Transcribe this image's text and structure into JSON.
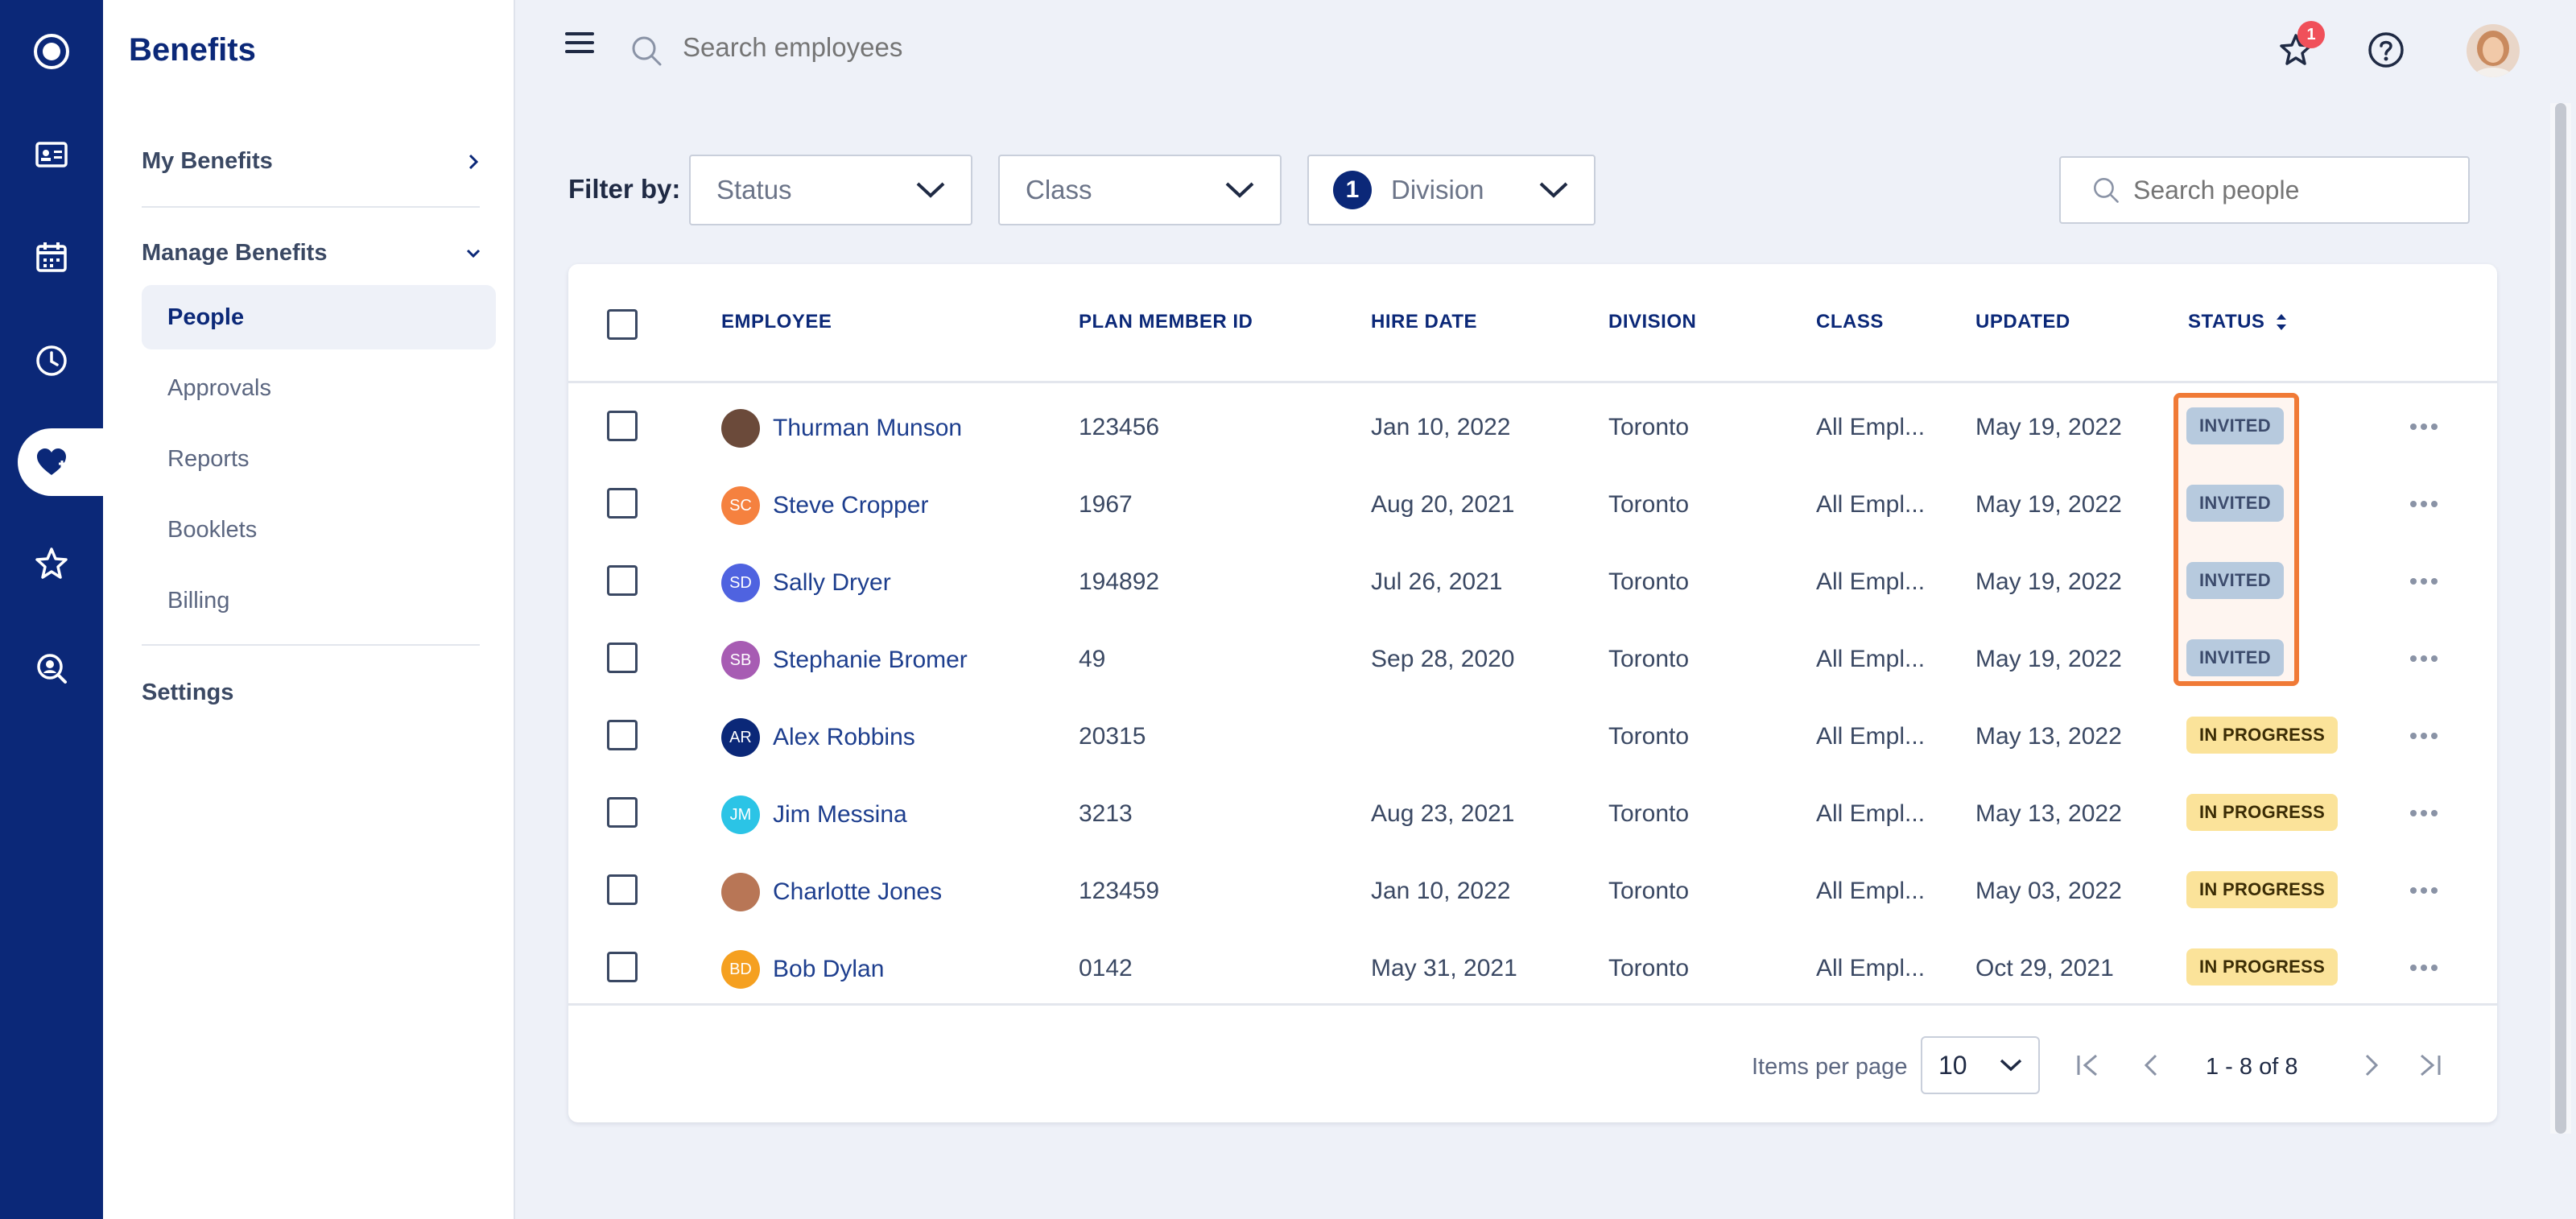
{
  "sidebar": {
    "title": "Benefits",
    "my_benefits": "My Benefits",
    "manage_benefits": "Manage Benefits",
    "items": [
      {
        "label": "People",
        "active": true
      },
      {
        "label": "Approvals"
      },
      {
        "label": "Reports"
      },
      {
        "label": "Booklets"
      },
      {
        "label": "Billing"
      }
    ],
    "settings": "Settings"
  },
  "rail_icons": [
    "logo-icon",
    "id-card-icon",
    "calendar-icon",
    "clock-icon",
    "benefits-heart-icon",
    "star-icon",
    "search-person-icon"
  ],
  "topbar": {
    "search_placeholder": "Search employees",
    "notification_count": "1"
  },
  "filters": {
    "label": "Filter by:",
    "status": "Status",
    "class": "Class",
    "division": "Division",
    "division_count": "1",
    "search_placeholder": "Search people"
  },
  "table": {
    "headers": {
      "employee": "EMPLOYEE",
      "plan_member_id": "PLAN MEMBER ID",
      "hire_date": "HIRE DATE",
      "division": "DIVISION",
      "class": "CLASS",
      "updated": "UPDATED",
      "status": "STATUS"
    },
    "rows": [
      {
        "initials": "",
        "avatar_color": "#6b4a3a",
        "name": "Thurman Munson",
        "id": "123456",
        "hire": "Jan 10, 2022",
        "division": "Toronto",
        "class": "All Empl...",
        "updated": "May 19, 2022",
        "status": "INVITED"
      },
      {
        "initials": "SC",
        "avatar_color": "#f5813f",
        "name": "Steve Cropper",
        "id": "1967",
        "hire": "Aug 20, 2021",
        "division": "Toronto",
        "class": "All Empl...",
        "updated": "May 19, 2022",
        "status": "INVITED"
      },
      {
        "initials": "SD",
        "avatar_color": "#4f63e0",
        "name": "Sally Dryer",
        "id": "194892",
        "hire": "Jul 26, 2021",
        "division": "Toronto",
        "class": "All Empl...",
        "updated": "May 19, 2022",
        "status": "INVITED"
      },
      {
        "initials": "SB",
        "avatar_color": "#a75cb3",
        "name": "Stephanie Bromer",
        "id": "49",
        "hire": "Sep 28, 2020",
        "division": "Toronto",
        "class": "All Empl...",
        "updated": "May 19, 2022",
        "status": "INVITED"
      },
      {
        "initials": "AR",
        "avatar_color": "#0b2878",
        "name": "Alex Robbins",
        "id": "20315",
        "hire": "",
        "division": "Toronto",
        "class": "All Empl...",
        "updated": "May 13, 2022",
        "status": "IN PROGRESS"
      },
      {
        "initials": "JM",
        "avatar_color": "#2bc4e6",
        "name": "Jim Messina",
        "id": "3213",
        "hire": "Aug 23, 2021",
        "division": "Toronto",
        "class": "All Empl...",
        "updated": "May 13, 2022",
        "status": "IN PROGRESS"
      },
      {
        "initials": "",
        "avatar_color": "#b87656",
        "name": "Charlotte Jones",
        "id": "123459",
        "hire": "Jan 10, 2022",
        "division": "Toronto",
        "class": "All Empl...",
        "updated": "May 03, 2022",
        "status": "IN PROGRESS"
      },
      {
        "initials": "BD",
        "avatar_color": "#f5a020",
        "name": "Bob Dylan",
        "id": "0142",
        "hire": "May 31, 2021",
        "division": "Toronto",
        "class": "All Empl...",
        "updated": "Oct 29, 2021",
        "status": "IN PROGRESS"
      }
    ]
  },
  "pagination": {
    "items_per_page_label": "Items per page",
    "items_per_page": "10",
    "range": "1 - 8 of 8"
  }
}
